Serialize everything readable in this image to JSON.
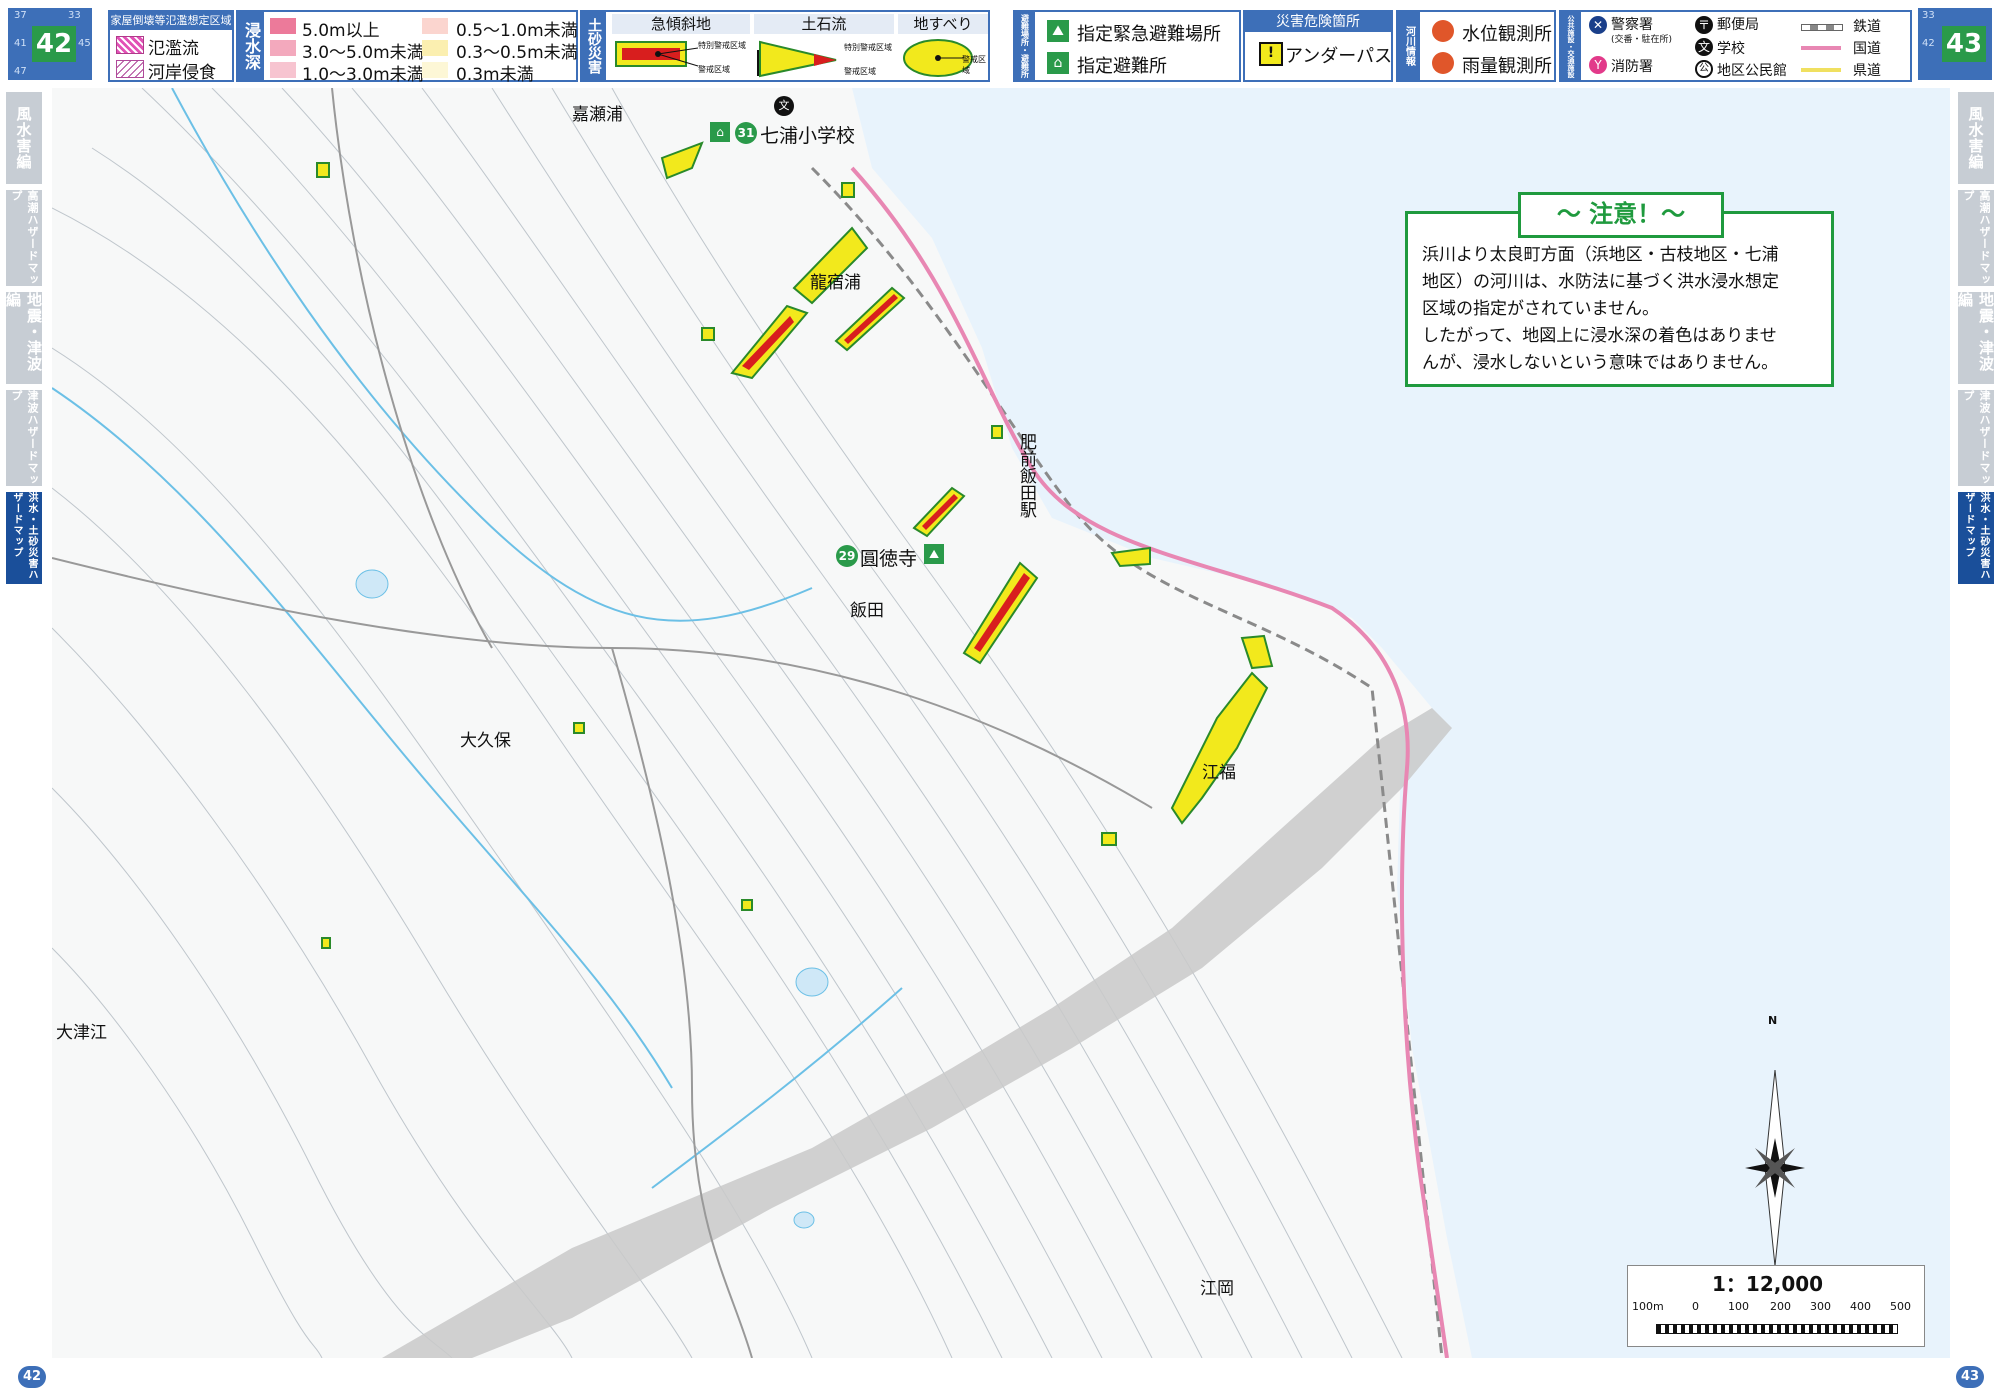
{
  "left_corner": {
    "page": "42",
    "small": [
      "37",
      "33",
      "41",
      "45",
      "47"
    ]
  },
  "right_corner": {
    "page": "43",
    "small": [
      "33",
      "42"
    ]
  },
  "legend_hazard": {
    "header": "家屋倒壊等氾濫想定区域",
    "items": [
      {
        "label": "氾濫流",
        "color": "#e252b6"
      },
      {
        "label": "河岸侵食",
        "color": "#b04a9a"
      }
    ]
  },
  "legend_depth": {
    "header": "浸水深",
    "items": [
      {
        "label": "5.0m以上",
        "color": "#ec7a9a"
      },
      {
        "label": "3.0～5.0m未満",
        "color": "#f3a9bd"
      },
      {
        "label": "1.0～3.0m未満",
        "color": "#f7c4d0"
      },
      {
        "label": "0.5～1.0m未満",
        "color": "#fbd5cf"
      },
      {
        "label": "0.3～0.5m未満",
        "color": "#fbefb0"
      },
      {
        "label": "0.3m未満",
        "color": "#fdf7d6"
      }
    ]
  },
  "legend_sediment": {
    "header": "土砂災害",
    "columns": [
      "急傾斜地",
      "土石流",
      "地すべり"
    ],
    "sub_labels": [
      "特別警戒区域",
      "警戒区域",
      "特別警戒区域",
      "警戒区域",
      "警戒区域"
    ]
  },
  "legend_shelter": {
    "header": "避難場所・避難所",
    "items": [
      "指定緊急避難場所",
      "指定避難所"
    ]
  },
  "legend_danger": {
    "header": "災害危険箇所",
    "item": "アンダーパス"
  },
  "legend_river": {
    "header": "河川情報",
    "items": [
      "水位観測所",
      "雨量観測所"
    ]
  },
  "legend_facility": {
    "header": "公共施設・交通施設",
    "items": [
      "警察署",
      "(交番・駐在所)",
      "郵便局",
      "消防署",
      "学校",
      "地区公民館"
    ],
    "routes": [
      {
        "label": "鉄道",
        "color": "#888888"
      },
      {
        "label": "国道",
        "color": "#e887b3"
      },
      {
        "label": "県道",
        "color": "#f0e060"
      }
    ]
  },
  "side_tabs_left": [
    "風水害編",
    "高潮ハザードマップ",
    "地震・津波編",
    "津波ハザードマップ",
    "洪水・土砂災害ハザードマップ"
  ],
  "side_tabs_right": [
    "風水害編",
    "高潮ハザードマップ",
    "地震・津波編",
    "津波ハザードマップ",
    "洪水・土砂災害ハザードマップ"
  ],
  "map": {
    "places": [
      "嘉瀬浦",
      "龍宿浦",
      "飯田",
      "大久保",
      "江福",
      "大津江",
      "江岡",
      "肥前飯田駅"
    ],
    "shelters": [
      {
        "number": "31",
        "name": "七浦小学校"
      },
      {
        "number": "29",
        "name": "圓徳寺"
      }
    ]
  },
  "notice": {
    "title": "～ 注意！～",
    "lines": [
      "浜川より太良町方面（浜地区・古枝地区・七浦",
      "地区）の河川は、水防法に基づく洪水浸水想定",
      "区域の指定がされていません。",
      "したがって、地図上に浸水深の着色はありませ",
      "んが、浸水しないという意味ではありません。"
    ]
  },
  "scale": {
    "ratio": "1：12,000",
    "ticks": [
      "100m",
      "0",
      "100",
      "200",
      "300",
      "400",
      "500"
    ]
  },
  "compass": {
    "north": "N"
  },
  "page_numbers": {
    "left": "42",
    "right": "43"
  }
}
